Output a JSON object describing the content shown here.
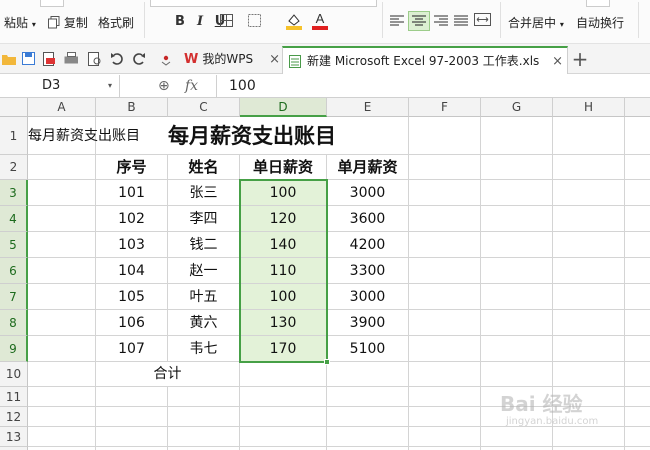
{
  "ribbon": {
    "paste_label": "粘贴",
    "copy_label": "复制",
    "format_painter_label": "格式刷",
    "bold_label": "B",
    "italic_label": "I",
    "underline_label": "U",
    "merge_center_label": "合并居中",
    "wrap_text_label": "自动换行"
  },
  "tabs": [
    {
      "label": "我的WPS"
    },
    {
      "label": "新建 Microsoft Excel 97-2003 工作表.xls"
    }
  ],
  "new_tab_label": "+",
  "close_glyph": "×",
  "formula_bar": {
    "name_box": "D3",
    "fx_label": "fx",
    "zoom_glyph": "⊕",
    "value": "100"
  },
  "columns": [
    "A",
    "B",
    "C",
    "D",
    "E",
    "F",
    "G",
    "H"
  ],
  "rows": [
    "1",
    "2",
    "3",
    "4",
    "5",
    "6",
    "7",
    "8",
    "9",
    "10",
    "11",
    "12",
    "13"
  ],
  "sheet": {
    "title": "每月薪资支出账目",
    "headers": [
      "序号",
      "姓名",
      "单日薪资",
      "单月薪资"
    ],
    "data": [
      [
        "101",
        "张三",
        "100",
        "3000"
      ],
      [
        "102",
        "李四",
        "120",
        "3600"
      ],
      [
        "103",
        "钱二",
        "140",
        "4200"
      ],
      [
        "104",
        "赵一",
        "110",
        "3300"
      ],
      [
        "105",
        "叶五",
        "100",
        "3000"
      ],
      [
        "106",
        "黄六",
        "130",
        "3900"
      ],
      [
        "107",
        "韦七",
        "170",
        "5100"
      ]
    ],
    "total_label": "合计"
  },
  "watermark": {
    "text": "Bai 经验",
    "url": "jingyan.baidu.com"
  },
  "colors": {
    "selection_border": "#2a8a2a",
    "selection_fill": "#e3f2d8",
    "header_selected": "#dfe9d5",
    "accent_green": "#46a046"
  }
}
